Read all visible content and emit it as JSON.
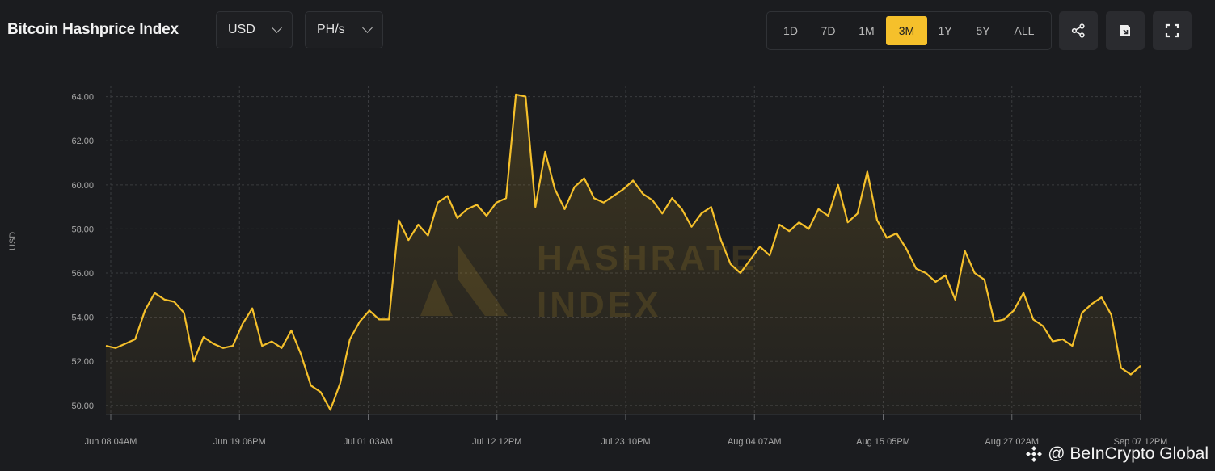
{
  "header": {
    "title": "Bitcoin Hashprice Index",
    "currency_select": "USD",
    "unit_select": "PH/s",
    "ranges": [
      "1D",
      "7D",
      "1M",
      "3M",
      "1Y",
      "5Y",
      "ALL"
    ],
    "active_range": "3M",
    "icons": [
      "share-icon",
      "screenshot-icon",
      "fullscreen-icon"
    ]
  },
  "watermark": {
    "line1": "HASHRATE",
    "line2": "INDEX"
  },
  "credit": "@ BeInCrypto Global",
  "colors": {
    "line": "#f5c02b",
    "background": "#1b1c1f",
    "accent": "#f5c02b"
  },
  "chart_data": {
    "type": "line",
    "title": "",
    "xlabel": "",
    "ylabel": "USD",
    "ylim": [
      49.7,
      64.5
    ],
    "yticks": [
      "64.00",
      "62.00",
      "60.00",
      "58.00",
      "56.00",
      "54.00",
      "52.00",
      "50.00"
    ],
    "xticks": [
      "Jun 08 04AM",
      "Jun 19 06PM",
      "Jul 01 03AM",
      "Jul 12 12PM",
      "Jul 23 10PM",
      "Aug 04 07AM",
      "Aug 15 05PM",
      "Aug 27 02AM",
      "Sep 07 12PM"
    ],
    "grid": true,
    "series": [
      {
        "values": [
          52.7,
          52.6,
          52.8,
          53.0,
          54.3,
          55.1,
          54.8,
          54.7,
          54.2,
          52.0,
          53.1,
          52.8,
          52.6,
          52.7,
          53.7,
          54.4,
          52.7,
          52.9,
          52.6,
          53.4,
          52.3,
          50.9,
          50.6,
          49.8,
          51.0,
          53.0,
          53.8,
          54.3,
          53.9,
          53.9,
          58.4,
          57.5,
          58.2,
          57.7,
          59.2,
          59.5,
          58.5,
          58.9,
          59.1,
          58.6,
          59.2,
          59.4,
          64.1,
          64.0,
          59.0,
          61.5,
          59.8,
          58.9,
          59.9,
          60.3,
          59.4,
          59.2,
          59.5,
          59.8,
          60.2,
          59.6,
          59.3,
          58.7,
          59.4,
          58.9,
          58.1,
          58.7,
          59.0,
          57.5,
          56.4,
          56.0,
          56.6,
          57.2,
          56.8,
          58.2,
          57.9,
          58.3,
          58.0,
          58.9,
          58.6,
          60.0,
          58.3,
          58.7,
          60.6,
          58.4,
          57.6,
          57.8,
          57.1,
          56.2,
          56.0,
          55.6,
          55.9,
          54.8,
          57.0,
          56.0,
          55.7,
          53.8,
          53.9,
          54.3,
          55.1,
          53.9,
          53.6,
          52.9,
          53.0,
          52.7,
          54.2,
          54.6,
          54.9,
          54.1,
          51.7,
          51.4,
          51.8
        ]
      }
    ]
  }
}
